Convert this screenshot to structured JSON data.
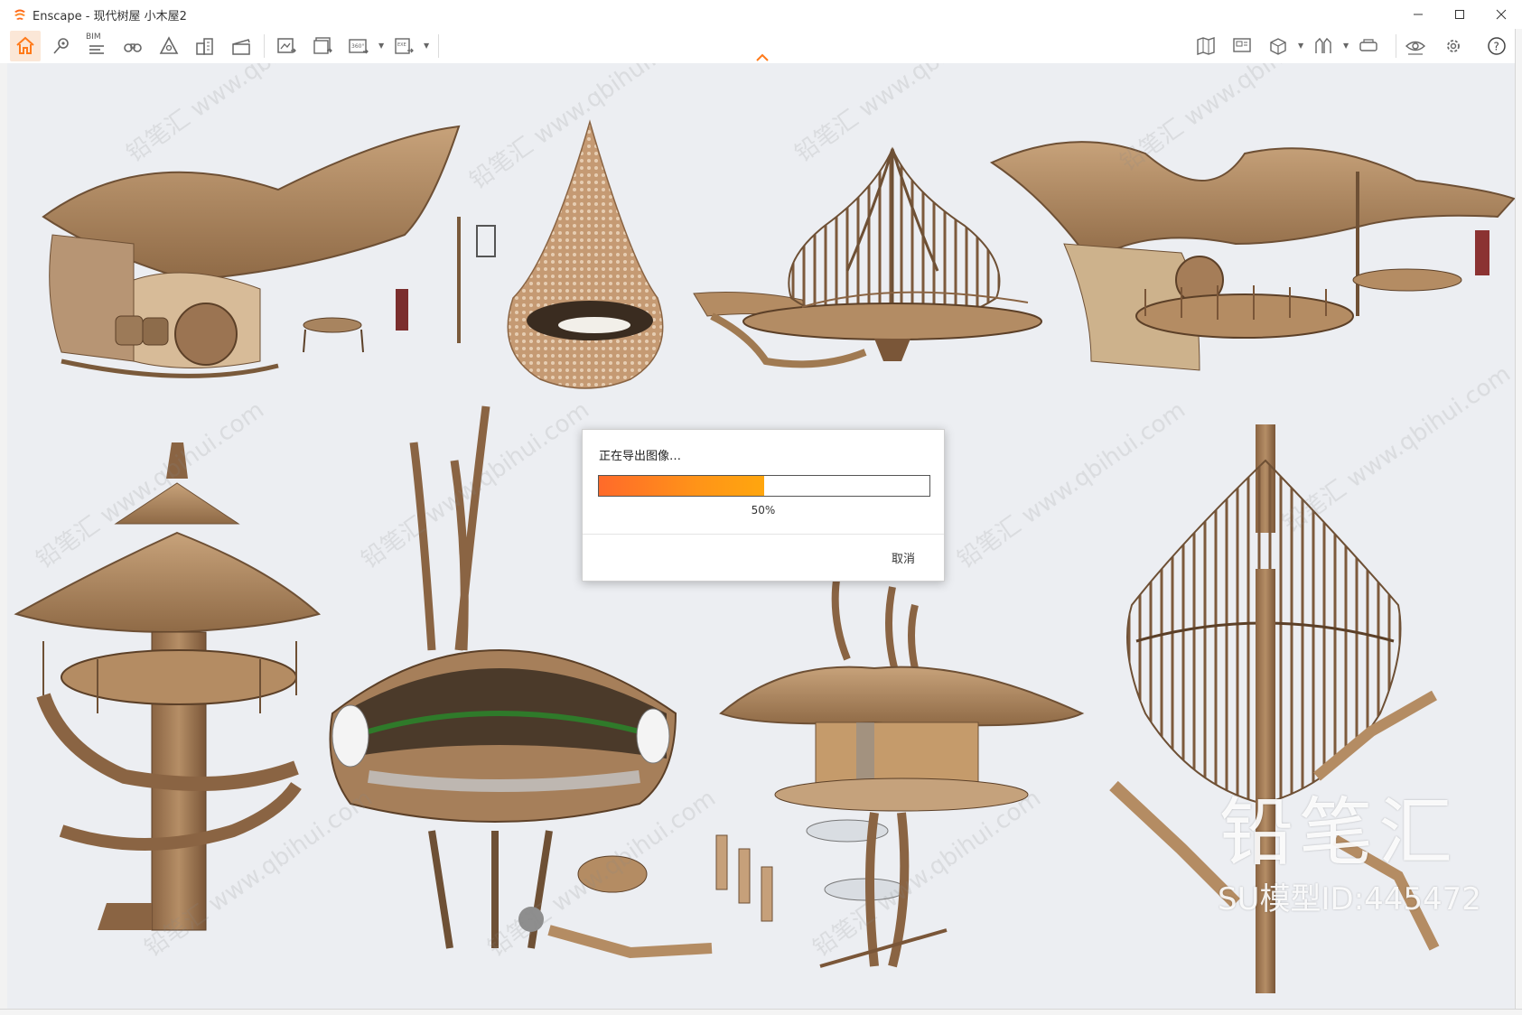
{
  "window": {
    "app_name": "Enscape",
    "title": "Enscape - 现代树屋 小木屋2",
    "controls": [
      "minimize-icon",
      "maximize-icon",
      "close-icon"
    ]
  },
  "toolbar": {
    "bim_label": "BIM",
    "left_icons": [
      "home-icon",
      "location-pin-icon",
      "bim-icon",
      "binoculars-icon",
      "atlas-icon",
      "buildings-icon",
      "clapper-icon"
    ],
    "export_icons": [
      "screenshot-icon",
      "batch-render-icon",
      "panorama-360-icon",
      "exe-export-icon"
    ],
    "right_icons": [
      "map-icon",
      "billboard-icon",
      "asset-library-icon",
      "material-icon",
      "vr-headset-icon",
      "view-settings-icon",
      "settings-icon",
      "help-icon"
    ]
  },
  "export_dialog": {
    "title": "正在导出图像…",
    "progress_percent": 50,
    "progress_label": "50%",
    "cancel_label": "取消"
  },
  "watermark": {
    "brand": "铅笔汇",
    "model_id": "SU模型ID:445472"
  },
  "colors": {
    "accent": "#ff7a1a",
    "viewport_bg": "#eceef2"
  }
}
